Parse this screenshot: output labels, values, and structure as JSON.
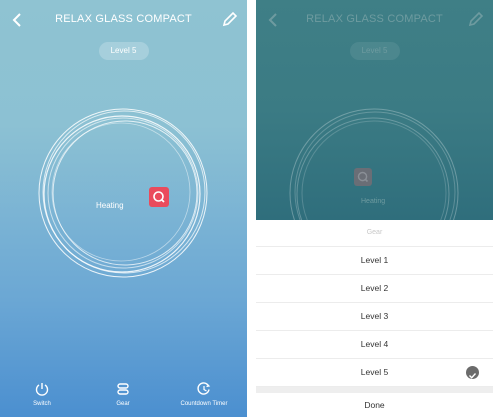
{
  "app": {
    "title": "RELAX GLASS COMPACT",
    "level_pill": "Level 5",
    "status_label": "Heating"
  },
  "bottom_bar": {
    "items": [
      {
        "label": "Switch",
        "icon": "power-icon"
      },
      {
        "label": "Gear",
        "icon": "gear-stack-icon"
      },
      {
        "label": "Countdown Timer",
        "icon": "timer-icon"
      }
    ]
  },
  "gear_sheet": {
    "header": "Gear",
    "options": [
      "Level 1",
      "Level 2",
      "Level 3",
      "Level 4",
      "Level 5"
    ],
    "selected": "Level 5",
    "done_label": "Done"
  },
  "colors": {
    "gradient_top": "#8fc3d2",
    "gradient_bottom": "#4b8fd0",
    "heating_accent": "#ea4b5c",
    "dimmed_bg": "#3b7b84",
    "check": "#6b6b6b"
  }
}
